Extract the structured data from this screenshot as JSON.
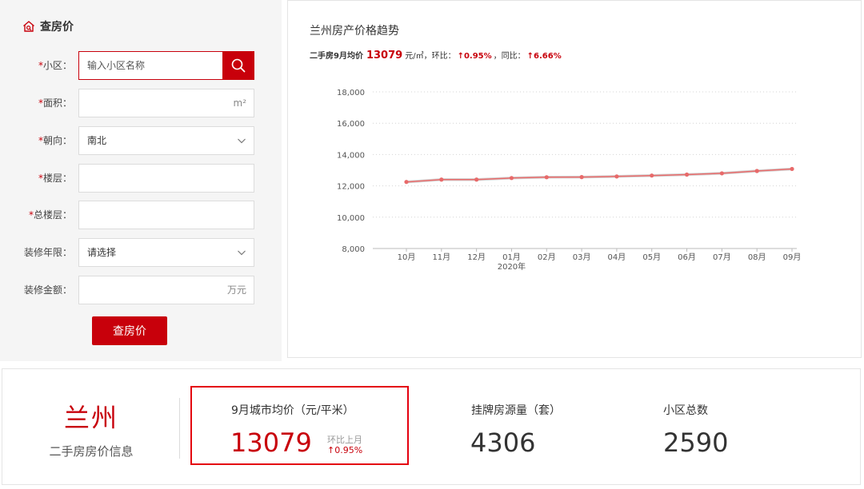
{
  "form": {
    "title": "查房价",
    "fields": [
      {
        "label": "小区：",
        "required": true,
        "placeholder": "输入小区名称"
      },
      {
        "label": "面积：",
        "required": true,
        "unit": "m²"
      },
      {
        "label": "朝向：",
        "required": true,
        "value": "南北"
      },
      {
        "label": "楼层：",
        "required": true
      },
      {
        "label": "总楼层：",
        "required": true
      },
      {
        "label": "装修年限：",
        "required": false,
        "value": "请选择"
      },
      {
        "label": "装修金额：",
        "required": false,
        "unit": "万元"
      }
    ],
    "required_mark": "*",
    "submit_label": "查房价"
  },
  "chart": {
    "title": "兰州房产价格趋势",
    "summary": {
      "prefix": "二手房9月均价",
      "price": "13079",
      "unit": "元/㎡，环比：",
      "mom": "↑0.95%",
      "mid": "，同比：",
      "yoy": "↑6.66%"
    }
  },
  "chart_data": {
    "type": "line",
    "categories": [
      "10月",
      "11月",
      "12月",
      "01月",
      "02月",
      "03月",
      "04月",
      "05月",
      "06月",
      "07月",
      "08月",
      "09月"
    ],
    "year_label": {
      "category": "01月",
      "text": "2020年"
    },
    "values": [
      12250,
      12400,
      12400,
      12500,
      12550,
      12560,
      12600,
      12660,
      12720,
      12800,
      12950,
      13079
    ],
    "ylim": [
      8000,
      18000
    ],
    "yticks": [
      "8,000",
      "10,000",
      "12,000",
      "14,000",
      "16,000",
      "18,000"
    ],
    "grid": true,
    "line_color": "#e86a6a"
  },
  "stats": {
    "city": "兰州",
    "city_sub": "二手房房价信息",
    "items": [
      {
        "label": "9月城市均价（元/平米）",
        "value": "13079",
        "note_label": "环比上月",
        "note_value": "↑0.95%"
      },
      {
        "label": "挂牌房源量（套）",
        "value": "4306"
      },
      {
        "label": "小区总数",
        "value": "2590"
      }
    ]
  },
  "colors": {
    "accent": "#c8000b",
    "highlight_border": "#e4000f",
    "panel_bg": "#f5f5f5"
  }
}
